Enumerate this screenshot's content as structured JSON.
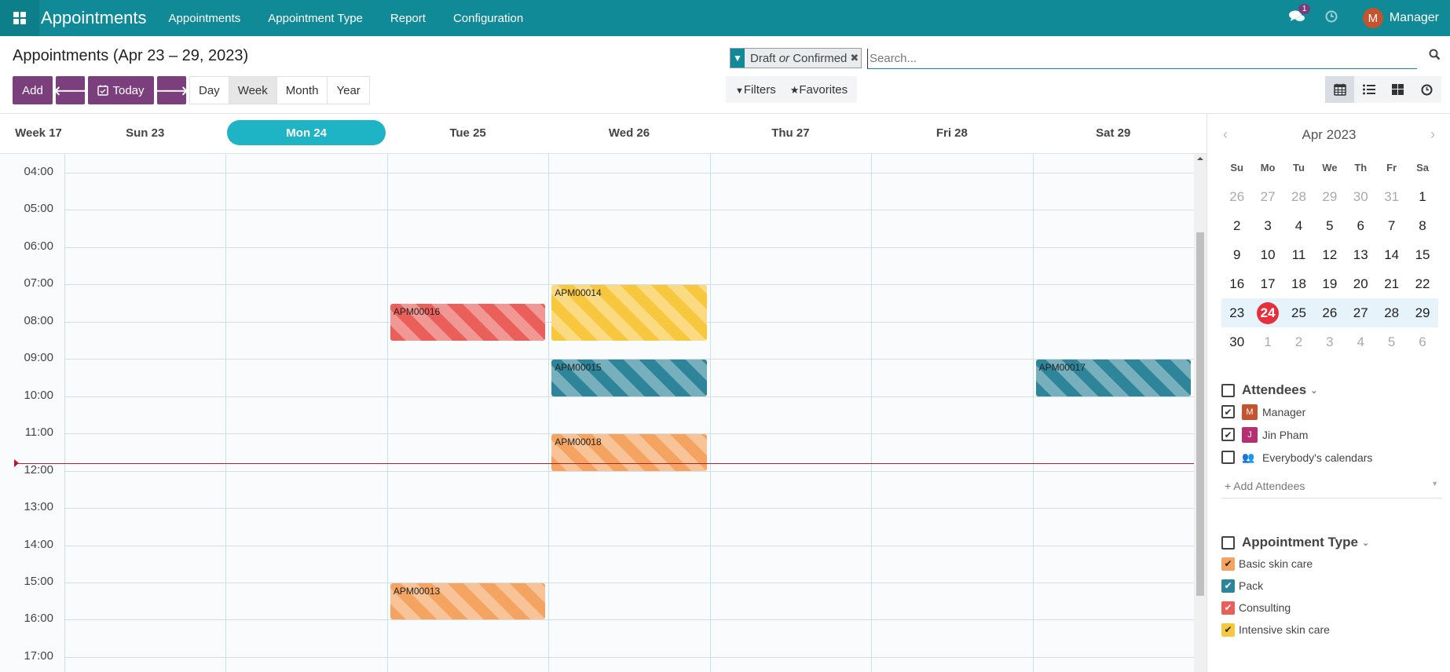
{
  "navbar": {
    "app_title": "Appointments",
    "menus": [
      "Appointments",
      "Appointment Type",
      "Report",
      "Configuration"
    ],
    "message_count": "1",
    "user_initial": "M",
    "user_name": "Manager"
  },
  "control_panel": {
    "title": "Appointments (Apr 23 – 29, 2023)",
    "add_label": "Add",
    "today_label": "Today",
    "scales": [
      "Day",
      "Week",
      "Month",
      "Year"
    ],
    "active_scale": "Week",
    "facet": {
      "part1": "Draft",
      "or": "or",
      "part2": "Confirmed"
    },
    "search_placeholder": "Search...",
    "filters_label": "Filters",
    "favorites_label": "Favorites",
    "views": [
      "calendar",
      "list",
      "kanban",
      "activity"
    ],
    "active_view": "calendar"
  },
  "calendar": {
    "week_label": "Week 17",
    "days": [
      "Sun 23",
      "Mon 24",
      "Tue 25",
      "Wed 26",
      "Thu 27",
      "Fri 28",
      "Sat 29"
    ],
    "today_index": 1,
    "hours": [
      "04:00",
      "05:00",
      "06:00",
      "07:00",
      "08:00",
      "09:00",
      "10:00",
      "11:00",
      "12:00",
      "13:00",
      "14:00",
      "15:00",
      "16:00",
      "17:00"
    ],
    "now_time": "11:48",
    "events": [
      {
        "name": "APM00016",
        "day": 2,
        "start": 7.5,
        "end": 8.5,
        "type": "Consulting"
      },
      {
        "name": "APM00014",
        "day": 3,
        "start": 7.0,
        "end": 8.5,
        "type": "Intensive skin care"
      },
      {
        "name": "APM00015",
        "day": 3,
        "start": 9.0,
        "end": 10.0,
        "type": "Pack"
      },
      {
        "name": "APM00018",
        "day": 3,
        "start": 11.0,
        "end": 12.0,
        "type": "Basic skin care"
      },
      {
        "name": "APM00017",
        "day": 6,
        "start": 9.0,
        "end": 10.0,
        "type": "Pack"
      },
      {
        "name": "APM00013",
        "day": 2,
        "start": 15.0,
        "end": 16.0,
        "type": "Basic skin care"
      }
    ]
  },
  "sidebar": {
    "month_label": "Apr 2023",
    "dow": [
      "Su",
      "Mo",
      "Tu",
      "We",
      "Th",
      "Fr",
      "Sa"
    ],
    "weeks": [
      [
        {
          "d": "26",
          "o": 1
        },
        {
          "d": "27",
          "o": 1
        },
        {
          "d": "28",
          "o": 1
        },
        {
          "d": "29",
          "o": 1
        },
        {
          "d": "30",
          "o": 1
        },
        {
          "d": "31",
          "o": 1
        },
        {
          "d": "1",
          "o": 0
        }
      ],
      [
        {
          "d": "2",
          "o": 0
        },
        {
          "d": "3",
          "o": 0
        },
        {
          "d": "4",
          "o": 0
        },
        {
          "d": "5",
          "o": 0
        },
        {
          "d": "6",
          "o": 0
        },
        {
          "d": "7",
          "o": 0
        },
        {
          "d": "8",
          "o": 0
        }
      ],
      [
        {
          "d": "9",
          "o": 0
        },
        {
          "d": "10",
          "o": 0
        },
        {
          "d": "11",
          "o": 0
        },
        {
          "d": "12",
          "o": 0
        },
        {
          "d": "13",
          "o": 0
        },
        {
          "d": "14",
          "o": 0
        },
        {
          "d": "15",
          "o": 0
        }
      ],
      [
        {
          "d": "16",
          "o": 0
        },
        {
          "d": "17",
          "o": 0
        },
        {
          "d": "18",
          "o": 0
        },
        {
          "d": "19",
          "o": 0
        },
        {
          "d": "20",
          "o": 0
        },
        {
          "d": "21",
          "o": 0
        },
        {
          "d": "22",
          "o": 0
        }
      ],
      [
        {
          "d": "23",
          "o": 0
        },
        {
          "d": "24",
          "o": 0,
          "t": 1
        },
        {
          "d": "25",
          "o": 0
        },
        {
          "d": "26",
          "o": 0
        },
        {
          "d": "27",
          "o": 0
        },
        {
          "d": "28",
          "o": 0
        },
        {
          "d": "29",
          "o": 0
        }
      ],
      [
        {
          "d": "30",
          "o": 0
        },
        {
          "d": "1",
          "o": 1
        },
        {
          "d": "2",
          "o": 1
        },
        {
          "d": "3",
          "o": 1
        },
        {
          "d": "4",
          "o": 1
        },
        {
          "d": "5",
          "o": 1
        },
        {
          "d": "6",
          "o": 1
        }
      ]
    ],
    "selected_week_index": 4,
    "attendees": {
      "title": "Attendees",
      "items": [
        {
          "label": "Manager",
          "initial": "M",
          "color": "#c4532e",
          "checked": true
        },
        {
          "label": "Jin Pham",
          "initial": "J",
          "color": "#b6306f",
          "checked": true
        },
        {
          "label": "Everybody's calendars",
          "icon": "users-icon",
          "checked": false
        }
      ],
      "add_label": "+ Add Attendees"
    },
    "appointment_types": {
      "title": "Appointment Type",
      "items": [
        {
          "label": "Basic skin care",
          "color": "#f4a460",
          "check_color": "#222"
        },
        {
          "label": "Pack",
          "color": "#2e8599",
          "check_color": "#fff"
        },
        {
          "label": "Consulting",
          "color": "#ea5f5a",
          "check_color": "#fff"
        },
        {
          "label": "Intensive skin care",
          "color": "#f7c83d",
          "check_color": "#222"
        }
      ]
    }
  },
  "colors": {
    "navbar": "#0f8a96",
    "primary": "#7b3f7e",
    "today_pill": "#1eb3c5",
    "now_line": "#b21f2d"
  }
}
